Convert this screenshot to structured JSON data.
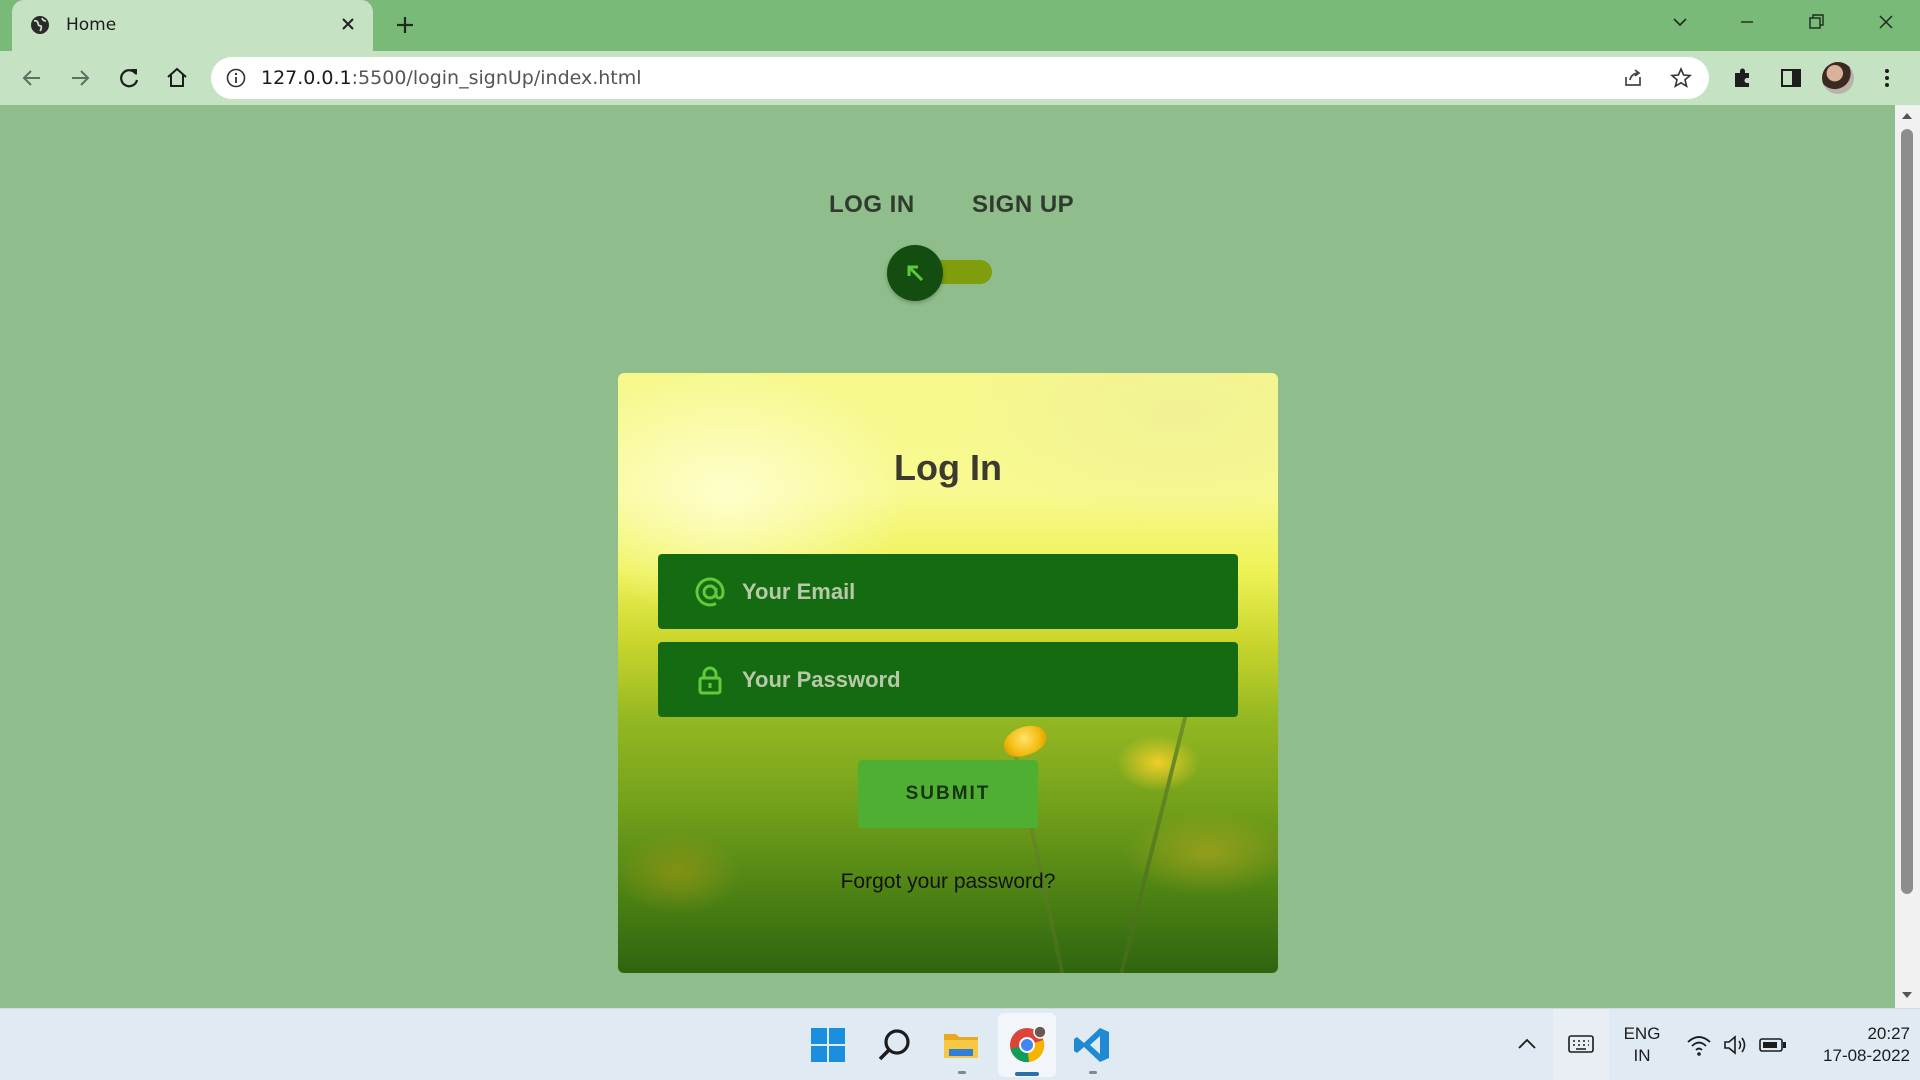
{
  "browser": {
    "tab_title": "Home",
    "url_host": "127.0.0.1",
    "url_rest": ":5500/login_signUp/index.html"
  },
  "page": {
    "nav": {
      "login_label": "LOG IN",
      "signup_label": "SIGN UP"
    },
    "toggle": {
      "state": "login"
    },
    "card": {
      "title": "Log In",
      "email_placeholder": "Your Email",
      "password_placeholder": "Your Password",
      "submit_label": "SUBMIT",
      "forgot_label": "Forgot your password?"
    }
  },
  "taskbar": {
    "apps": [
      "windows-start",
      "search",
      "file-explorer",
      "chrome",
      "vscode"
    ],
    "lang_line1": "ENG",
    "lang_line2": "IN",
    "time": "20:27",
    "date": "17-08-2022"
  },
  "colors": {
    "page_bg": "#8fbe8c",
    "tabstrip_bg": "#7aba78",
    "toolbar_bg": "#c5e3c3",
    "field_bg": "#156b11",
    "submit_bg": "#4faf33",
    "toggle_knob": "#134d0f",
    "toggle_track": "#7f9d0c"
  }
}
